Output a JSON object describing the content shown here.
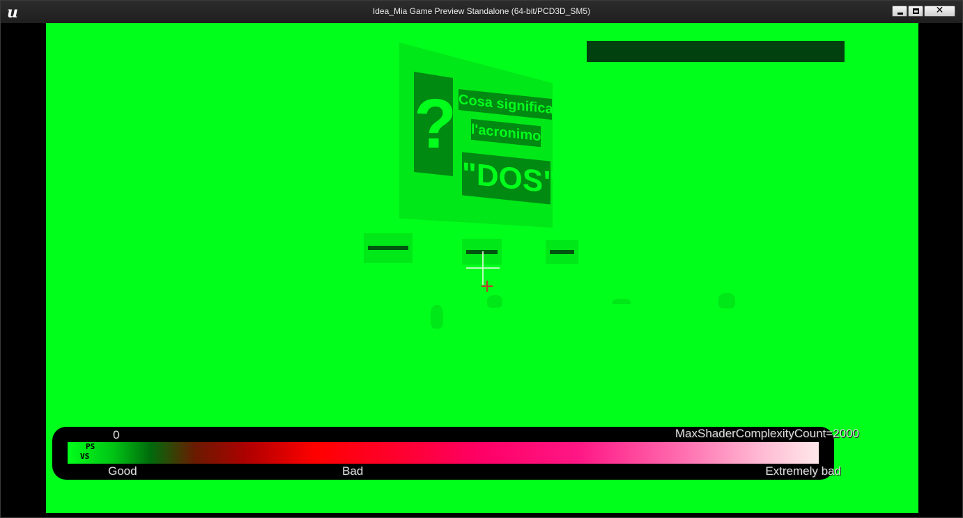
{
  "window": {
    "title": "Idea_Mia Game Preview Standalone (64-bit/PCD3D_SM5)",
    "logo_text": "u",
    "controls": {
      "close_glyph": "✕"
    }
  },
  "viewport": {
    "background_color": "#00ff1b",
    "billboard": {
      "question_mark": "?",
      "line1": "Cosa significa",
      "line2": "l'acronimo",
      "line3": "\"DOS\""
    }
  },
  "shader_legend": {
    "min_value": "0",
    "max_label": "MaxShaderComplexityCount=2000",
    "good_label": "Good",
    "bad_label": "Bad",
    "extremely_bad_label": "Extremely bad",
    "ps_label": "PS",
    "vs_label": "VS"
  }
}
